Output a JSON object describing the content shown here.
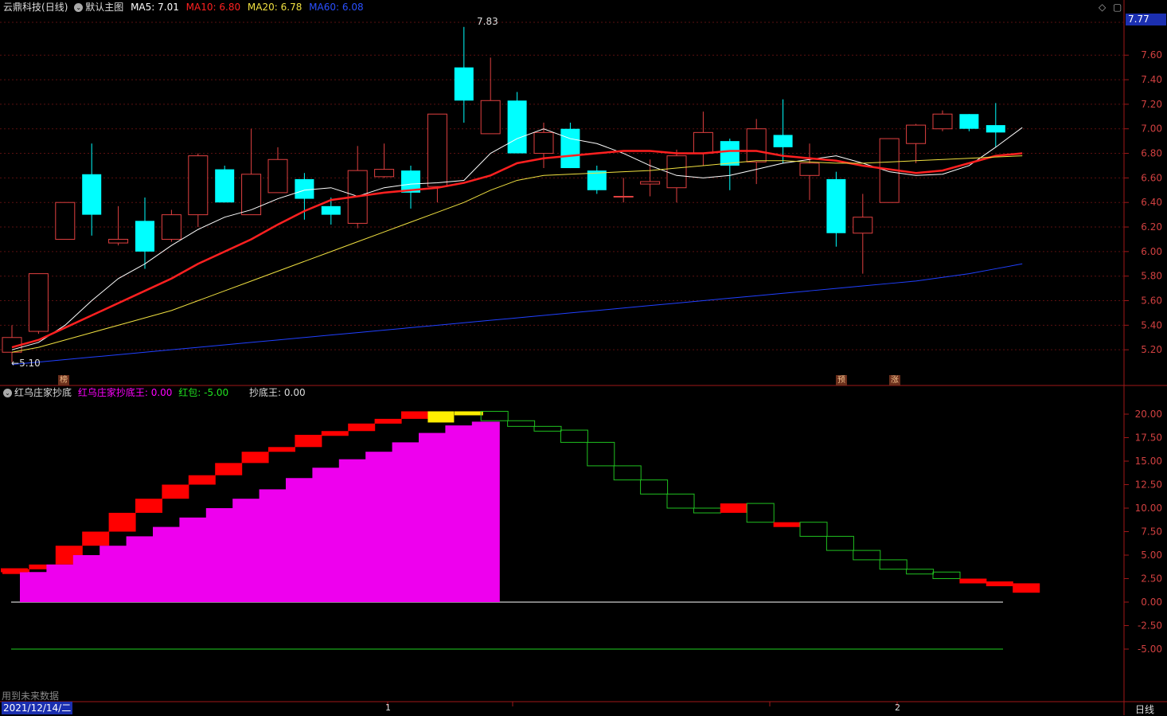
{
  "stock": {
    "name": "云鼎科技",
    "period": "(日线)"
  },
  "main_chart": {
    "label": "默认主图",
    "ma": [
      {
        "name": "MA5",
        "value": "7.01",
        "color": "#ffffff"
      },
      {
        "name": "MA10",
        "value": "6.80",
        "color": "#ff2020"
      },
      {
        "name": "MA20",
        "value": "6.78",
        "color": "#f0e040"
      },
      {
        "name": "MA60",
        "value": "6.08",
        "color": "#2040ff"
      }
    ],
    "price_tag": "7.77",
    "high_mark": "7.83",
    "low_mark": "5.10",
    "tags": [
      "榜",
      "预",
      "涨"
    ]
  },
  "sub_chart": {
    "title": "红乌庄家抄底",
    "indicators": [
      {
        "name": "红乌庄家抄底王",
        "value": "0.00",
        "color": "#ff00ff"
      },
      {
        "name": "红包",
        "value": "-5.00",
        "color": "#20e020"
      },
      {
        "name": "抄底王",
        "value": "0.00",
        "color": "#dddddd"
      }
    ]
  },
  "footer": {
    "note": "用到未来数据",
    "date": "2021/12/14/二",
    "period_button": "日线",
    "month_marks": [
      "1",
      "2"
    ]
  },
  "chart_data": [
    {
      "type": "candlestick",
      "ylim": [
        5.0,
        7.9
      ],
      "yticks": [
        5.2,
        5.4,
        5.6,
        5.8,
        6.0,
        6.2,
        6.4,
        6.6,
        6.8,
        7.0,
        7.2,
        7.4,
        7.6
      ],
      "candles": [
        {
          "o": 5.18,
          "h": 5.4,
          "l": 5.1,
          "c": 5.3
        },
        {
          "o": 5.35,
          "h": 5.82,
          "l": 5.33,
          "c": 5.82
        },
        {
          "o": 6.1,
          "h": 6.4,
          "l": 6.1,
          "c": 6.4
        },
        {
          "o": 6.63,
          "h": 6.88,
          "l": 6.13,
          "c": 6.3
        },
        {
          "o": 6.07,
          "h": 6.37,
          "l": 6.05,
          "c": 6.1
        },
        {
          "o": 6.25,
          "h": 6.44,
          "l": 5.86,
          "c": 6.0
        },
        {
          "o": 6.1,
          "h": 6.34,
          "l": 6.08,
          "c": 6.3
        },
        {
          "o": 6.3,
          "h": 6.8,
          "l": 6.2,
          "c": 6.78
        },
        {
          "o": 6.67,
          "h": 6.7,
          "l": 6.4,
          "c": 6.4
        },
        {
          "o": 6.3,
          "h": 7.0,
          "l": 6.3,
          "c": 6.63
        },
        {
          "o": 6.48,
          "h": 6.85,
          "l": 6.48,
          "c": 6.75
        },
        {
          "o": 6.59,
          "h": 6.64,
          "l": 6.26,
          "c": 6.43
        },
        {
          "o": 6.37,
          "h": 6.44,
          "l": 6.22,
          "c": 6.3
        },
        {
          "o": 6.23,
          "h": 6.86,
          "l": 6.19,
          "c": 6.66
        },
        {
          "o": 6.61,
          "h": 6.88,
          "l": 6.6,
          "c": 6.67
        },
        {
          "o": 6.66,
          "h": 6.7,
          "l": 6.35,
          "c": 6.48
        },
        {
          "o": 6.53,
          "h": 7.12,
          "l": 6.4,
          "c": 7.12
        },
        {
          "o": 7.5,
          "h": 7.83,
          "l": 7.05,
          "c": 7.23
        },
        {
          "o": 6.96,
          "h": 7.58,
          "l": 6.96,
          "c": 7.23
        },
        {
          "o": 7.23,
          "h": 7.3,
          "l": 6.8,
          "c": 6.8
        },
        {
          "o": 6.8,
          "h": 7.05,
          "l": 6.68,
          "c": 6.97
        },
        {
          "o": 7.0,
          "h": 7.05,
          "l": 6.68,
          "c": 6.68
        },
        {
          "o": 6.66,
          "h": 6.7,
          "l": 6.47,
          "c": 6.5
        },
        {
          "o": 6.45,
          "h": 6.6,
          "l": 6.4,
          "c": 6.45
        },
        {
          "o": 6.55,
          "h": 6.75,
          "l": 6.45,
          "c": 6.57
        },
        {
          "o": 6.52,
          "h": 6.83,
          "l": 6.4,
          "c": 6.78
        },
        {
          "o": 6.8,
          "h": 7.14,
          "l": 6.7,
          "c": 6.97
        },
        {
          "o": 6.9,
          "h": 6.92,
          "l": 6.5,
          "c": 6.7
        },
        {
          "o": 6.73,
          "h": 7.08,
          "l": 6.55,
          "c": 7.0
        },
        {
          "o": 6.95,
          "h": 7.24,
          "l": 6.72,
          "c": 6.85
        },
        {
          "o": 6.62,
          "h": 6.88,
          "l": 6.42,
          "c": 6.72
        },
        {
          "o": 6.59,
          "h": 6.65,
          "l": 6.04,
          "c": 6.15
        },
        {
          "o": 6.15,
          "h": 6.47,
          "l": 5.82,
          "c": 6.28
        },
        {
          "o": 6.4,
          "h": 6.92,
          "l": 6.4,
          "c": 6.92
        },
        {
          "o": 6.88,
          "h": 7.04,
          "l": 6.72,
          "c": 7.03
        },
        {
          "o": 7.0,
          "h": 7.15,
          "l": 6.98,
          "c": 7.12
        },
        {
          "o": 7.12,
          "h": 7.12,
          "l": 6.98,
          "c": 7.0
        },
        {
          "o": 7.03,
          "h": 7.21,
          "l": 6.85,
          "c": 6.97
        }
      ],
      "series": [
        {
          "name": "MA5",
          "color": "#ffffff",
          "values": [
            5.2,
            5.26,
            5.4,
            5.6,
            5.78,
            5.9,
            6.05,
            6.18,
            6.28,
            6.34,
            6.43,
            6.5,
            6.52,
            6.45,
            6.52,
            6.55,
            6.56,
            6.58,
            6.8,
            6.92,
            7.0,
            6.92,
            6.88,
            6.8,
            6.7,
            6.62,
            6.6,
            6.62,
            6.67,
            6.72,
            6.75,
            6.78,
            6.72,
            6.65,
            6.62,
            6.63,
            6.7,
            6.85,
            7.01
          ]
        },
        {
          "name": "MA10",
          "color": "#ff2020",
          "values": [
            5.22,
            5.28,
            5.38,
            5.48,
            5.58,
            5.68,
            5.78,
            5.9,
            6.0,
            6.1,
            6.22,
            6.33,
            6.42,
            6.45,
            6.48,
            6.5,
            6.52,
            6.56,
            6.62,
            6.72,
            6.76,
            6.78,
            6.8,
            6.82,
            6.82,
            6.8,
            6.8,
            6.82,
            6.82,
            6.78,
            6.76,
            6.74,
            6.7,
            6.67,
            6.64,
            6.66,
            6.72,
            6.78,
            6.8
          ]
        },
        {
          "name": "MA20",
          "color": "#f0e040",
          "values": [
            5.18,
            5.22,
            5.28,
            5.34,
            5.4,
            5.46,
            5.52,
            5.6,
            5.68,
            5.76,
            5.84,
            5.92,
            6.0,
            6.08,
            6.16,
            6.24,
            6.32,
            6.4,
            6.5,
            6.58,
            6.62,
            6.63,
            6.64,
            6.65,
            6.66,
            6.68,
            6.7,
            6.72,
            6.74,
            6.74,
            6.73,
            6.72,
            6.72,
            6.73,
            6.74,
            6.75,
            6.76,
            6.77,
            6.78
          ]
        },
        {
          "name": "MA60",
          "color": "#2040ff",
          "values": [
            5.08,
            5.1,
            5.12,
            5.14,
            5.16,
            5.18,
            5.2,
            5.22,
            5.24,
            5.26,
            5.28,
            5.3,
            5.32,
            5.34,
            5.36,
            5.38,
            5.4,
            5.42,
            5.44,
            5.46,
            5.48,
            5.5,
            5.52,
            5.54,
            5.56,
            5.58,
            5.6,
            5.62,
            5.64,
            5.66,
            5.68,
            5.7,
            5.72,
            5.74,
            5.76,
            5.79,
            5.82,
            5.86,
            5.9
          ]
        }
      ]
    },
    {
      "type": "bar",
      "title": "红乌庄家抄底",
      "ylim": [
        -5.0,
        20.0
      ],
      "yticks": [
        -5.0,
        -2.5,
        0.0,
        2.5,
        5.0,
        7.5,
        10.0,
        12.5,
        15.0,
        17.5,
        20.0
      ],
      "series": [
        {
          "name": "红乌庄家抄底王",
          "color": "#ee00ee",
          "values": [
            3.2,
            4.0,
            5.0,
            6.0,
            7.0,
            8.0,
            9.0,
            10.0,
            11.0,
            12.0,
            13.2,
            14.3,
            15.2,
            16.0,
            17.0,
            18.0,
            18.8,
            19.2
          ]
        },
        {
          "name": "庄家线",
          "values": [
            3.5,
            4.0,
            6.0,
            7.5,
            9.5,
            11.0,
            12.5,
            13.5,
            14.8,
            16.0,
            16.5,
            17.8,
            18.2,
            19.0,
            19.5,
            20.3,
            20.5,
            20.3,
            19.3,
            18.7,
            18.3,
            17.0,
            14.5,
            13.0,
            11.5,
            10.0,
            9.5,
            10.5,
            8.5,
            8.5,
            7.0,
            5.5,
            4.5,
            3.5,
            3.2,
            2.5,
            2.2,
            2.0,
            1.0
          ]
        },
        {
          "name": "红包",
          "color": "#20e020",
          "values": [
            -5.0
          ]
        },
        {
          "name": "抄底王",
          "color": "#dddddd",
          "values": [
            0.0
          ]
        }
      ]
    }
  ]
}
